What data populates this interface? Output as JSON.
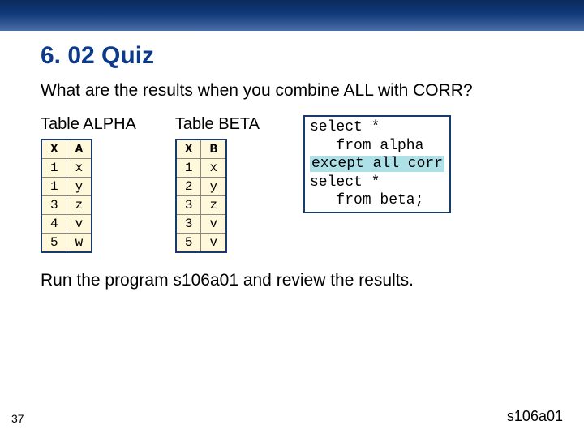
{
  "heading": "6. 02 Quiz",
  "question": "What are the results when you combine ALL with CORR?",
  "alpha": {
    "caption": "Table ALPHA",
    "cols": [
      "X",
      "A"
    ],
    "rows": [
      [
        "1",
        "x"
      ],
      [
        "1",
        "y"
      ],
      [
        "3",
        "z"
      ],
      [
        "4",
        "v"
      ],
      [
        "5",
        "w"
      ]
    ]
  },
  "beta": {
    "caption": "Table BETA",
    "cols": [
      "X",
      "B"
    ],
    "rows": [
      [
        "1",
        "x"
      ],
      [
        "2",
        "y"
      ],
      [
        "3",
        "z"
      ],
      [
        "3",
        "v"
      ],
      [
        "5",
        "v"
      ]
    ]
  },
  "code": {
    "l1": "select *",
    "l2": "   from alpha",
    "l3": "except all corr",
    "l4": "select *",
    "l5": "   from beta;"
  },
  "run_note": "Run the program s106a01 and review the results.",
  "filename": "s106a01",
  "page": "37",
  "chart_data": [
    {
      "type": "table",
      "title": "Table ALPHA",
      "columns": [
        "X",
        "A"
      ],
      "rows": [
        [
          "1",
          "x"
        ],
        [
          "1",
          "y"
        ],
        [
          "3",
          "z"
        ],
        [
          "4",
          "v"
        ],
        [
          "5",
          "w"
        ]
      ]
    },
    {
      "type": "table",
      "title": "Table BETA",
      "columns": [
        "X",
        "B"
      ],
      "rows": [
        [
          "1",
          "x"
        ],
        [
          "2",
          "y"
        ],
        [
          "3",
          "z"
        ],
        [
          "3",
          "v"
        ],
        [
          "5",
          "v"
        ]
      ]
    }
  ]
}
